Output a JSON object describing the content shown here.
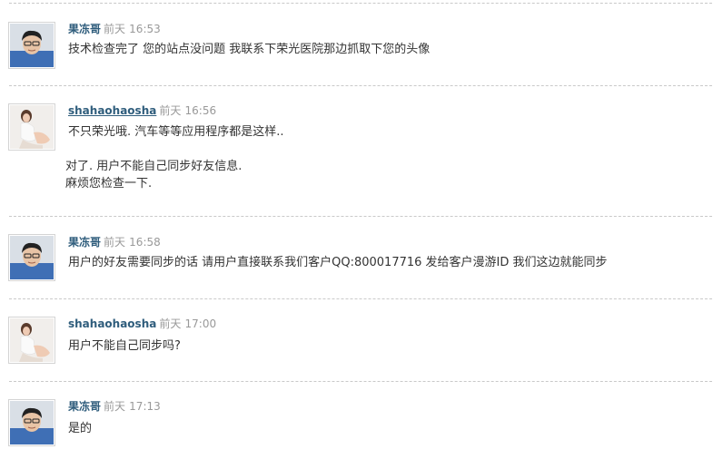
{
  "thread": {
    "posts": [
      {
        "author": "果冻哥",
        "author_is_link": false,
        "avatar": "male-avatar",
        "day": "前天",
        "time": "16:53",
        "lines": [
          "技术检查完了 您的站点没问题 我联系下荣光医院那边抓取下您的头像"
        ]
      },
      {
        "author": "shahaohaosha",
        "author_is_link": true,
        "avatar": "female-avatar",
        "day": "前天",
        "time": "16:56",
        "lines": [
          "不只荣光哦. 汽车等等应用程序都是这样..",
          "",
          "对了. 用户不能自己同步好友信息.",
          "麻烦您检查一下."
        ]
      },
      {
        "author": "果冻哥",
        "author_is_link": false,
        "avatar": "male-avatar",
        "day": "前天",
        "time": "16:58",
        "lines": [
          "用户的好友需要同步的话 请用户直接联系我们客户QQ:800017716 发给客户漫游ID 我们这边就能同步"
        ]
      },
      {
        "author": "shahaohaosha",
        "author_is_link": false,
        "avatar": "female-avatar",
        "day": "前天",
        "time": "17:00",
        "lines": [
          "用户不能自己同步吗?"
        ]
      },
      {
        "author": "果冻哥",
        "author_is_link": false,
        "avatar": "male-avatar",
        "day": "前天",
        "time": "17:13",
        "lines": [
          "是的"
        ]
      }
    ]
  },
  "colors": {
    "author": "#2f5d7c",
    "timestamp": "#999999",
    "text": "#333333",
    "divider": "#c9c9c9"
  }
}
